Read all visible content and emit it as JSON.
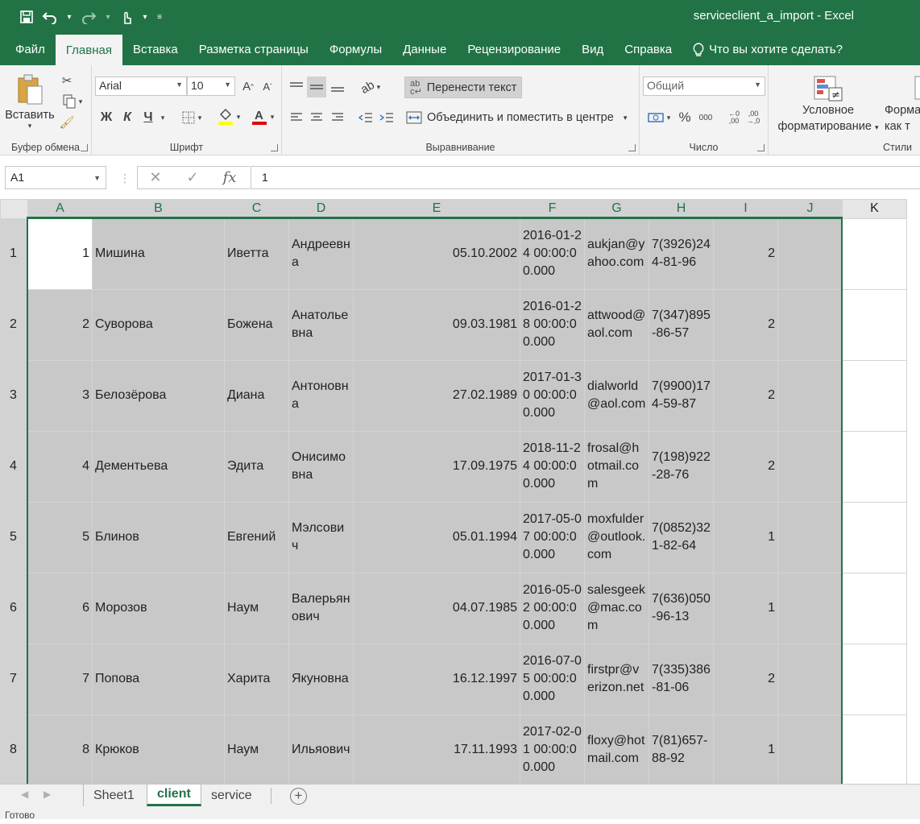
{
  "app": {
    "title": "serviceclient_a_import  -  Excel",
    "accent": "#217346"
  },
  "qat": {
    "icons": [
      "save-icon",
      "undo-icon",
      "redo-icon",
      "touch-mode-icon",
      "customize-qat-icon"
    ]
  },
  "tabs": [
    {
      "label": "Файл"
    },
    {
      "label": "Главная"
    },
    {
      "label": "Вставка"
    },
    {
      "label": "Разметка страницы"
    },
    {
      "label": "Формулы"
    },
    {
      "label": "Данные"
    },
    {
      "label": "Рецензирование"
    },
    {
      "label": "Вид"
    },
    {
      "label": "Справка"
    },
    {
      "label": "Что вы хотите сделать?"
    }
  ],
  "ribbon": {
    "clipboard": {
      "paste_label": "Вставить",
      "group_label": "Буфер обмена"
    },
    "font": {
      "family": "Arial",
      "size": "10",
      "bold": "Ж",
      "italic": "К",
      "underline": "Ч",
      "group_label": "Шрифт"
    },
    "alignment": {
      "wrap_label": "Перенести текст",
      "merge_label": "Объединить и поместить в центре",
      "group_label": "Выравнивание"
    },
    "number": {
      "format": "Общий",
      "group_label": "Число"
    },
    "styles": {
      "cond_format_line1": "Условное",
      "cond_format_line2": "форматирование",
      "table_format_line1": "Форма",
      "table_format_line2": "как т",
      "group_label": "Стили"
    }
  },
  "formula_bar": {
    "name_box": "A1",
    "value": "1"
  },
  "columns": [
    "A",
    "B",
    "C",
    "D",
    "E",
    "F",
    "G",
    "H",
    "I",
    "J",
    "K"
  ],
  "rows": [
    {
      "num": "1",
      "a": "1",
      "b": "Мишина",
      "c": "Иветта",
      "d": "Андреевна",
      "e": "05.10.2002",
      "f": "2016-01-24 00:00:00.000",
      "g": "aukjan@yahoo.com",
      "h": "7(3926)244-81-96",
      "i": "2"
    },
    {
      "num": "2",
      "a": "2",
      "b": "Суворова",
      "c": "Божена",
      "d": "Анатольевна",
      "e": "09.03.1981",
      "f": "2016-01-28 00:00:00.000",
      "g": "attwood@aol.com",
      "h": "7(347)895-86-57",
      "i": "2"
    },
    {
      "num": "3",
      "a": "3",
      "b": "Белозёрова",
      "c": "Диана",
      "d": "Антоновна",
      "e": "27.02.1989",
      "f": "2017-01-30 00:00:00.000",
      "g": "dialworld@aol.com",
      "h": "7(9900)174-59-87",
      "i": "2"
    },
    {
      "num": "4",
      "a": "4",
      "b": "Дементьева",
      "c": "Эдита",
      "d": "Онисимовна",
      "e": "17.09.1975",
      "f": "2018-11-24 00:00:00.000",
      "g": "frosal@hotmail.com",
      "h": "7(198)922-28-76",
      "i": "2"
    },
    {
      "num": "5",
      "a": "5",
      "b": "Блинов",
      "c": "Евгений",
      "d": "Мэлсович",
      "e": "05.01.1994",
      "f": "2017-05-07 00:00:00.000",
      "g": "moxfulder@outlook.com",
      "h": "7(0852)321-82-64",
      "i": "1"
    },
    {
      "num": "6",
      "a": "6",
      "b": "Морозов",
      "c": "Наум",
      "d": "Валерьянович",
      "e": "04.07.1985",
      "f": "2016-05-02 00:00:00.000",
      "g": "salesgeek@mac.com",
      "h": "7(636)050-96-13",
      "i": "1"
    },
    {
      "num": "7",
      "a": "7",
      "b": "Попова",
      "c": "Харита",
      "d": "Якуновна",
      "e": "16.12.1997",
      "f": "2016-07-05 00:00:00.000",
      "g": "firstpr@verizon.net",
      "h": "7(335)386-81-06",
      "i": "2"
    },
    {
      "num": "8",
      "a": "8",
      "b": "Крюков",
      "c": "Наум",
      "d": "Ильяович",
      "e": "17.11.1993",
      "f": "2017-02-01 00:00:00.000",
      "g": "floxy@hotmail.com",
      "h": "7(81)657-88-92",
      "i": "1"
    }
  ],
  "sheet_tabs": [
    {
      "label": "Sheet1"
    },
    {
      "label": "client"
    },
    {
      "label": "service"
    }
  ],
  "status": {
    "text": "Готово"
  }
}
